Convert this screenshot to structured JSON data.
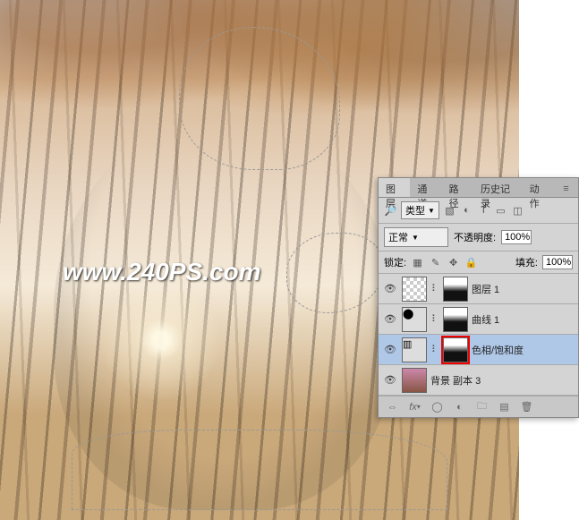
{
  "watermark": "www.240PS.com",
  "panel": {
    "tabs": [
      "图层",
      "通道",
      "路径",
      "历史记录",
      "动作"
    ],
    "active_tab": 0,
    "filter": {
      "label": "类型",
      "icons": [
        "img-icon",
        "adjust-icon",
        "text-icon",
        "shape-icon",
        "smart-icon"
      ]
    },
    "blend": {
      "mode": "正常",
      "opacity_label": "不透明度:",
      "opacity_value": "100%"
    },
    "lock": {
      "label": "锁定:",
      "fill_label": "填充:",
      "fill_value": "100%"
    },
    "layers": [
      {
        "visible": true,
        "type": "raster",
        "has_mask": true,
        "name": "图层 1",
        "selected": false,
        "mask_highlight": false
      },
      {
        "visible": true,
        "type": "adjust",
        "has_mask": true,
        "name": "曲线 1",
        "selected": false,
        "mask_highlight": false
      },
      {
        "visible": true,
        "type": "adjust",
        "has_mask": true,
        "name": "色相/饱和度",
        "selected": true,
        "mask_highlight": true
      },
      {
        "visible": true,
        "type": "raster",
        "has_mask": false,
        "name": "背景 副本 3",
        "selected": false,
        "mask_highlight": false
      }
    ],
    "footer_icons": [
      "link-icon",
      "fx-icon",
      "mask-icon",
      "adjustment-icon",
      "group-icon",
      "new-icon",
      "trash-icon"
    ]
  },
  "colors": {
    "panel_bg": "#d4d4d4",
    "selected_layer": "#b0c8e8",
    "highlight": "#e00000"
  }
}
